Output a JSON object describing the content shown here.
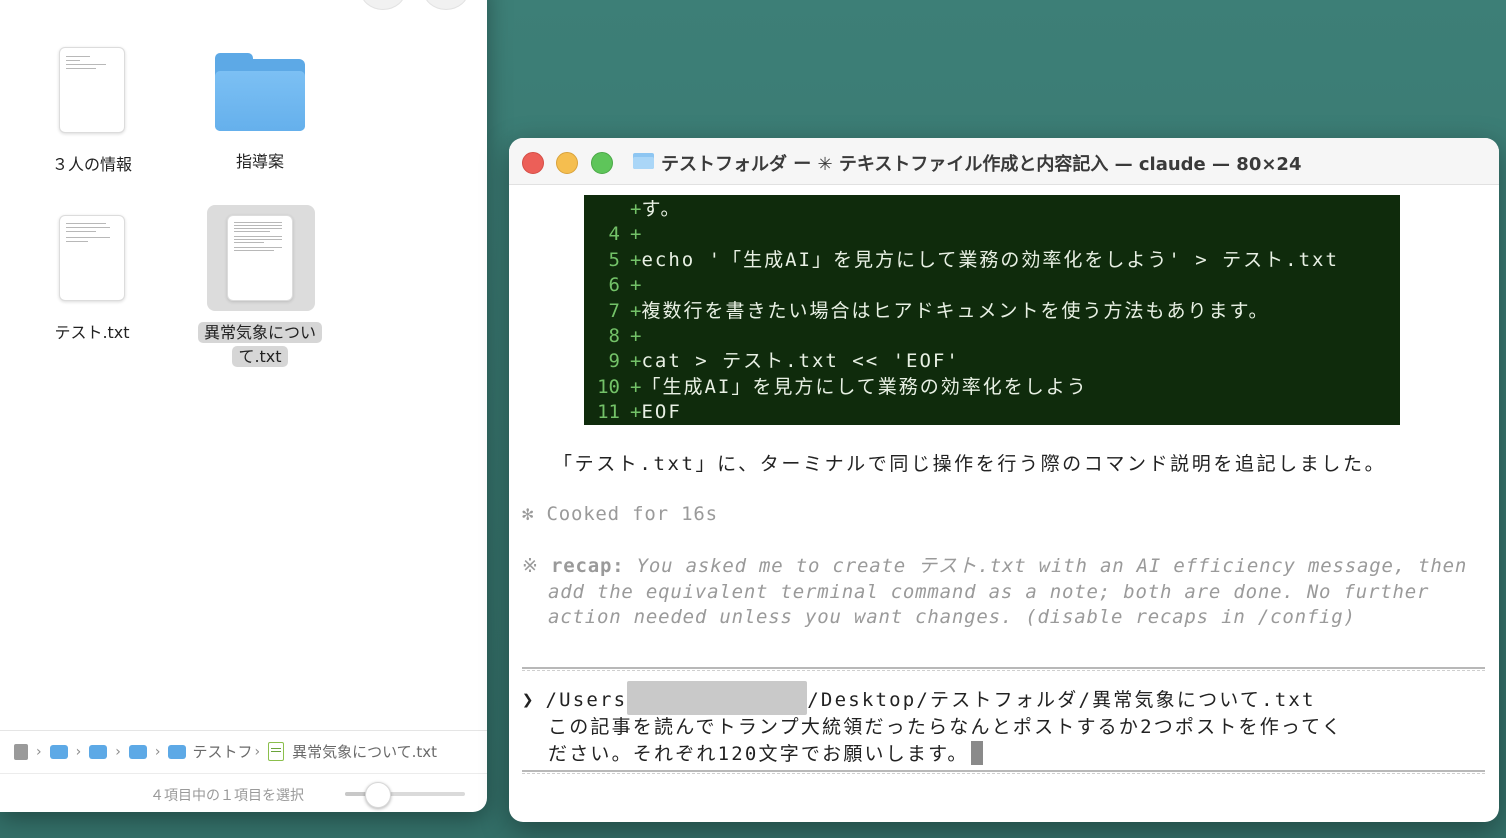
{
  "finder": {
    "items": [
      {
        "name": "３人の情報"
      },
      {
        "name": "指導案"
      },
      {
        "name": "テスト.txt"
      },
      {
        "name_line1": "異常気象につい",
        "name_line2": "て.txt"
      }
    ],
    "pathbar": {
      "folder_label": "テストフ",
      "file_label": "異常気象について.txt"
    },
    "status_text": "４項目中の１項目を選択",
    "zoom_level": 0.27
  },
  "terminal": {
    "title": "テストフォルダ ー ✳ テキストファイル作成と内容記入 — claude — 80×24",
    "diff_lines": [
      {
        "num": "",
        "text": "す。"
      },
      {
        "num": "4",
        "text": ""
      },
      {
        "num": "5",
        "text": "echo '「生成AI」を見方にして業務の効率化をしよう' > テスト.txt"
      },
      {
        "num": "6",
        "text": ""
      },
      {
        "num": "7",
        "text": "複数行を書きたい場合はヒアドキュメントを使う方法もあります。"
      },
      {
        "num": "8",
        "text": ""
      },
      {
        "num": "9",
        "text": "cat > テスト.txt << 'EOF'"
      },
      {
        "num": "10",
        "text": "「生成AI」を見方にして業務の効率化をしよう"
      },
      {
        "num": "11",
        "text": "EOF"
      }
    ],
    "plus_sign": "+",
    "message": "「テスト.txt」に、ターミナルで同じ操作を行う際のコマンド説明を追記しました。",
    "cooked": "✻ Cooked for 16s",
    "recap": {
      "marker": "※",
      "label": "recap:",
      "line1": "You asked me to create テスト.txt with an AI efficiency message, then",
      "line2": "add the equivalent terminal command as a note; both are done. No further",
      "line3": "action needed unless you want changes. (disable recaps in /config)"
    },
    "prompt": {
      "arrow": "❯",
      "path_start": "/Users",
      "path_end": "/Desktop/テストフォルダ/異常気象について.txt",
      "line2": "この記事を読んでトランプ大統領だったらなんとポストするか2つポストを作ってく",
      "line3": "ださい。それぞれ120文字でお願いします。"
    }
  }
}
